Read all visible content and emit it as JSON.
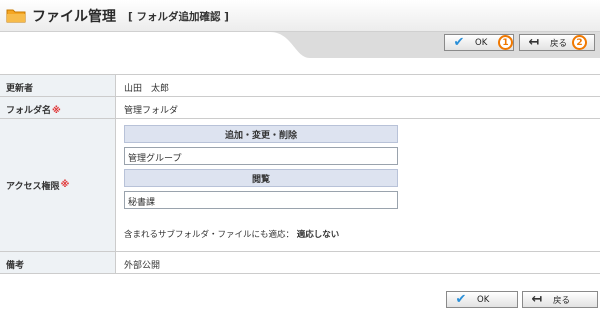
{
  "header": {
    "title": "ファイル管理",
    "subtitle": "[ フォルダ追加確認 ]",
    "icon": "folder-icon"
  },
  "toolbar": {
    "ok_label": "OK",
    "back_label": "戻る",
    "marker_1": "1",
    "marker_2": "2"
  },
  "form": {
    "updater": {
      "label": "更新者",
      "value": "山田　太郎"
    },
    "folder_name": {
      "label": "フォルダ名",
      "required": "※",
      "value": "管理フォルダ"
    },
    "access": {
      "label": "アクセス権限",
      "required": "※",
      "edit_header": "追加・変更・削除",
      "edit_value": "管理グループ",
      "view_header": "閲覧",
      "view_value": "秘書課",
      "include_label": "含まれるサブフォルダ・ファイルにも適応：",
      "include_value": "適応しない"
    },
    "note": {
      "label": "備考",
      "value": "外部公開"
    }
  },
  "colors": {
    "accent": "#2a8fd8",
    "marker": "#f07800",
    "required": "#e03030",
    "label_bg": "#eef2f5",
    "perm_header_bg": "#dde3f0"
  }
}
